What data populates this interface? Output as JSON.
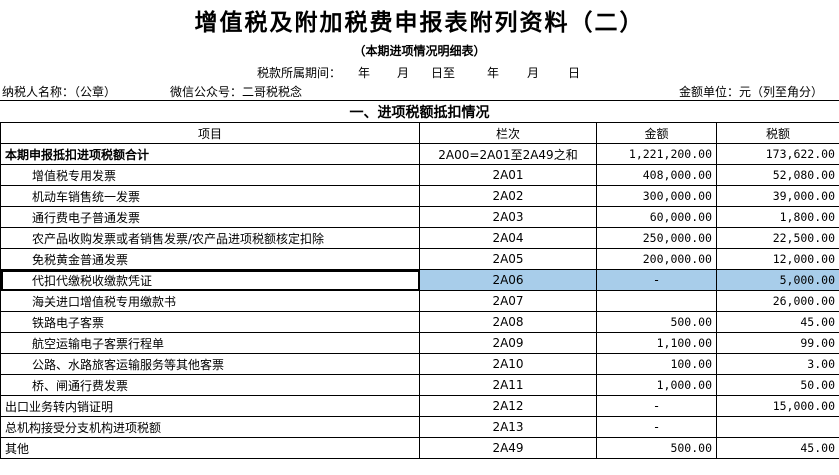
{
  "header": {
    "title": "增值税及附加税费申报表附列资料（二）",
    "subtitle": "（本期进项情况明细表）",
    "period": {
      "label": "税款所属期间：",
      "year1": "年",
      "month1": "月",
      "day_to": "日至",
      "year2": "年",
      "month2": "月",
      "day2": "日"
    },
    "taxpayer_label": "纳税人名称：（公章）",
    "wechat_label": "微信公众号：二哥税税念",
    "unit_label": "金额单位：元（列至角分）"
  },
  "section_title": "一、进项税额抵扣情况",
  "table": {
    "columns": [
      "项目",
      "栏次",
      "金额",
      "税额"
    ],
    "rows": [
      {
        "item": "本期申报抵扣进项税额合计",
        "code": "2A00=2A01至2A49之和",
        "amount": "1,221,200.00",
        "tax": "173,622.00"
      },
      {
        "item": "增值税专用发票",
        "code": "2A01",
        "amount": "408,000.00",
        "tax": "52,080.00"
      },
      {
        "item": "机动车销售统一发票",
        "code": "2A02",
        "amount": "300,000.00",
        "tax": "39,000.00"
      },
      {
        "item": "通行费电子普通发票",
        "code": "2A03",
        "amount": "60,000.00",
        "tax": "1,800.00"
      },
      {
        "item": "农产品收购发票或者销售发票/农产品进项税额核定扣除",
        "code": "2A04",
        "amount": "250,000.00",
        "tax": "22,500.00"
      },
      {
        "item": "免税黄金普通发票",
        "code": "2A05",
        "amount": "200,000.00",
        "tax": "12,000.00"
      },
      {
        "item": "代扣代缴税收缴款凭证",
        "code": "2A06",
        "amount": "-",
        "tax": "5,000.00"
      },
      {
        "item": "海关进口增值税专用缴款书",
        "code": "2A07",
        "amount": "",
        "tax": "26,000.00"
      },
      {
        "item": "铁路电子客票",
        "code": "2A08",
        "amount": "500.00",
        "tax": "45.00"
      },
      {
        "item": "航空运输电子客票行程单",
        "code": "2A09",
        "amount": "1,100.00",
        "tax": "99.00"
      },
      {
        "item": "公路、水路旅客运输服务等其他客票",
        "code": "2A10",
        "amount": "100.00",
        "tax": "3.00"
      },
      {
        "item": "桥、闸通行费发票",
        "code": "2A11",
        "amount": "1,000.00",
        "tax": "50.00"
      },
      {
        "item": "出口业务转内销证明",
        "code": "2A12",
        "amount": "-",
        "tax": "15,000.00"
      },
      {
        "item": "总机构接受分支机构进项税额",
        "code": "2A13",
        "amount": "-",
        "tax": ""
      },
      {
        "item": "其他",
        "code": "2A49",
        "amount": "500.00",
        "tax": "45.00"
      }
    ]
  }
}
